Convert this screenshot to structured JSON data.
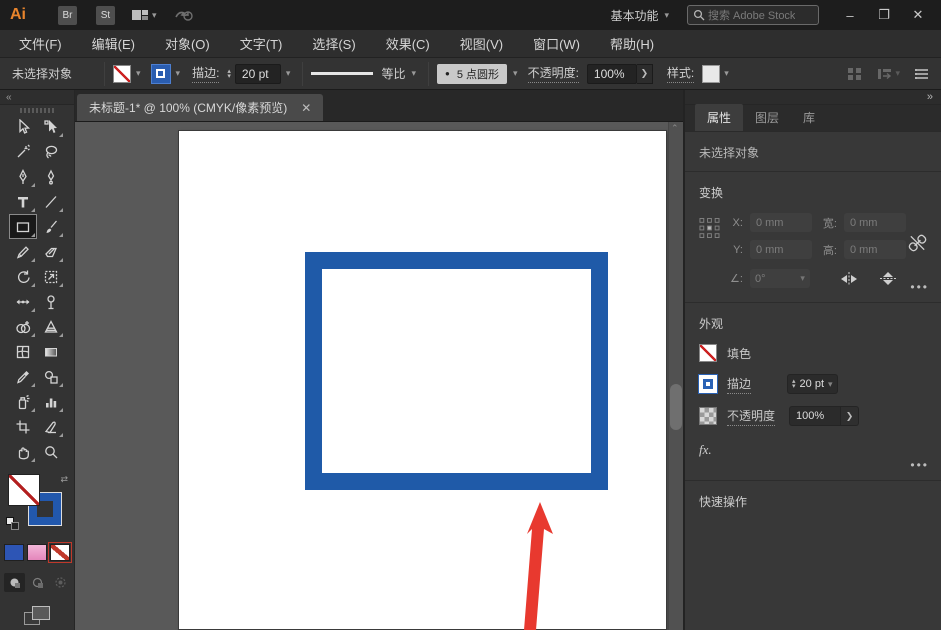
{
  "titlebar": {
    "logo": "Ai",
    "bridge_label": "Br",
    "stock_label": "St",
    "workspace": "基本功能",
    "search_placeholder": "搜索 Adobe Stock",
    "icons": {
      "minimize": "–",
      "maximize": "❐",
      "close": "✕",
      "workspace_chevron": "▾",
      "arranger_chevron": "▾"
    }
  },
  "menubar": {
    "items": [
      "文件(F)",
      "编辑(E)",
      "对象(O)",
      "文字(T)",
      "选择(S)",
      "效果(C)",
      "视图(V)",
      "窗口(W)",
      "帮助(H)"
    ]
  },
  "controlbar": {
    "status": "未选择对象",
    "stroke_label": "描边:",
    "stroke_weight": "20 pt",
    "profile_label": "等比",
    "brush_dot": "●",
    "brush_label": "5 点圆形",
    "opacity_label": "不透明度:",
    "opacity_value": "100%",
    "opacity_more": "❯",
    "style_label": "样式:"
  },
  "document_tab": {
    "title": "未标题-1* @ 100% (CMYK/像素预览)",
    "close": "✕"
  },
  "toolbar": {
    "collapse": "«",
    "tools": [
      {
        "name": "selection-tool",
        "flyout": false,
        "selected": false
      },
      {
        "name": "direct-selection-tool",
        "flyout": true,
        "selected": false
      },
      {
        "name": "magic-wand-tool",
        "flyout": false,
        "selected": false
      },
      {
        "name": "lasso-tool",
        "flyout": false,
        "selected": false
      },
      {
        "name": "pen-tool",
        "flyout": true,
        "selected": false
      },
      {
        "name": "curvature-tool",
        "flyout": false,
        "selected": false
      },
      {
        "name": "type-tool",
        "flyout": true,
        "selected": false
      },
      {
        "name": "line-segment-tool",
        "flyout": true,
        "selected": false
      },
      {
        "name": "rectangle-tool",
        "flyout": true,
        "selected": true
      },
      {
        "name": "paintbrush-tool",
        "flyout": true,
        "selected": false
      },
      {
        "name": "shaper-tool",
        "flyout": true,
        "selected": false
      },
      {
        "name": "eraser-tool",
        "flyout": true,
        "selected": false
      },
      {
        "name": "rotate-tool",
        "flyout": true,
        "selected": false
      },
      {
        "name": "scale-tool",
        "flyout": true,
        "selected": false
      },
      {
        "name": "width-tool",
        "flyout": true,
        "selected": false
      },
      {
        "name": "puppet-warp-tool",
        "flyout": false,
        "selected": false
      },
      {
        "name": "shape-builder-tool",
        "flyout": true,
        "selected": false
      },
      {
        "name": "perspective-grid-tool",
        "flyout": true,
        "selected": false
      },
      {
        "name": "mesh-tool",
        "flyout": false,
        "selected": false
      },
      {
        "name": "gradient-tool",
        "flyout": false,
        "selected": false
      },
      {
        "name": "eyedropper-tool",
        "flyout": true,
        "selected": false
      },
      {
        "name": "symbol-tool",
        "flyout": true,
        "selected": false
      },
      {
        "name": "symbol-sprayer-tool",
        "flyout": true,
        "selected": false
      },
      {
        "name": "graph-tool",
        "flyout": true,
        "selected": false
      },
      {
        "name": "artboard-tool",
        "flyout": false,
        "selected": false
      },
      {
        "name": "slice-tool",
        "flyout": true,
        "selected": false
      },
      {
        "name": "hand-tool",
        "flyout": true,
        "selected": false
      },
      {
        "name": "zoom-tool",
        "flyout": false,
        "selected": false
      }
    ]
  },
  "panel": {
    "collapse": "»",
    "tabs": [
      {
        "label": "属性",
        "active": true
      },
      {
        "label": "图层",
        "active": false
      },
      {
        "label": "库",
        "active": false
      }
    ],
    "no_selection": "未选择对象",
    "transform": {
      "title": "变换",
      "x_label": "X:",
      "x_value": "0 mm",
      "y_label": "Y:",
      "y_value": "0 mm",
      "w_label": "宽:",
      "w_value": "0 mm",
      "h_label": "高:",
      "h_value": "0 mm",
      "angle_label": "∠:",
      "angle_value": "0°",
      "more": "•••"
    },
    "appearance": {
      "title": "外观",
      "fill_label": "填色",
      "stroke_label": "描边",
      "stroke_weight": "20 pt",
      "opacity_label": "不透明度",
      "opacity_value": "100%",
      "opacity_more": "❯",
      "fx_label": "fx.",
      "more": "•••"
    },
    "quick_actions_title": "快速操作"
  },
  "colors": {
    "rect_stroke_blue": "#1f5aa8",
    "arrow_red": "#e8392f",
    "proxy_blue": "#2258ad",
    "gradient_pink": "#e9a0c9",
    "logo_orange": "#e8842c"
  },
  "canvas": {
    "zoom_percent": "100%"
  }
}
